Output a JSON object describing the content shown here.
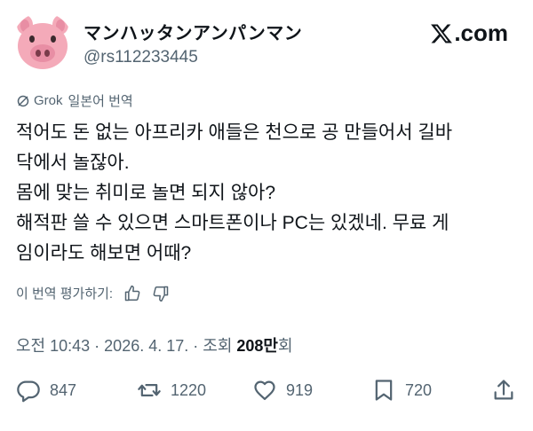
{
  "header": {
    "display_name": "マンハッタンアンパンマン",
    "handle": "@rs112233445",
    "brand": ".com",
    "avatar_icon": "pig-face-icon"
  },
  "translation": {
    "source": "Grok",
    "label": "일본어 번역"
  },
  "tweet": {
    "lines": [
      "적어도 돈 없는 아프리카 애들은 천으로 공 만들어서 길바",
      "닥에서 놀잖아.",
      "몸에 맞는 취미로 놀면 되지 않아?",
      "해적판 쓸 수 있으면 스마트폰이나 PC는 있겠네. 무료 게",
      "임이라도 해보면 어때?"
    ]
  },
  "rate": {
    "label": "이 번역 평가하기:"
  },
  "meta": {
    "time": "오전 10:43",
    "dot1": " · ",
    "date": "2026. 4. 17.",
    "dot2": " · ",
    "views_prefix": "조회 ",
    "views_count": "208만",
    "views_suffix": "회"
  },
  "actions": {
    "replies": "847",
    "reposts": "1220",
    "likes": "919",
    "bookmarks": "720"
  },
  "colors": {
    "text": "#0f1419",
    "secondary": "#536471",
    "pig_pink": "#f4aab9",
    "pig_snout": "#e88ea4"
  }
}
